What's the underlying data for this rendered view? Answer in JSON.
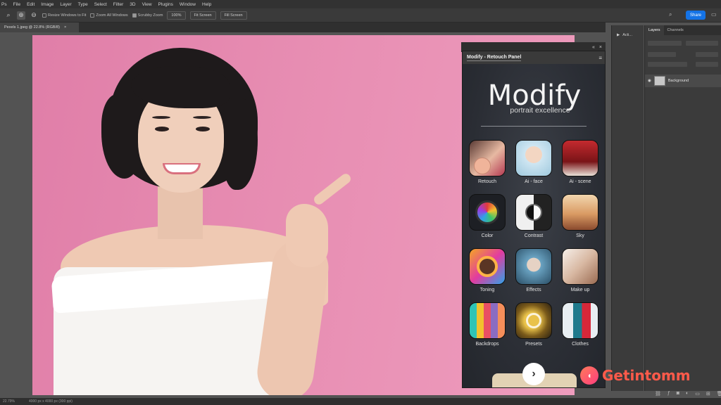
{
  "menu": [
    "Ps",
    "File",
    "Edit",
    "Image",
    "Layer",
    "Type",
    "Select",
    "Filter",
    "3D",
    "View",
    "Plugins",
    "Window",
    "Help"
  ],
  "options": {
    "resize_windows": "Resize Windows to Fit",
    "zoom_all": "Zoom All Windows",
    "scrubby_zoom": "Scrubby Zoom",
    "btn_100": "100%",
    "btn_fit": "Fit Screen",
    "btn_fill": "Fill Screen",
    "share": "Share"
  },
  "document": {
    "tab_title": "Pexels 1.jpeg @ 22.8% (RGB/8)",
    "close": "×"
  },
  "actions_tab": "Acti...",
  "panels": {
    "tabs": [
      "Layers",
      "Channels"
    ],
    "layer_name": "Background"
  },
  "modify": {
    "panel_title": "Modify - Retouch Panel",
    "logo": "Modify",
    "tagline": "portrait excellence",
    "tiles": [
      {
        "label": "Retouch"
      },
      {
        "label": "Ai - face"
      },
      {
        "label": "Ai - scene"
      },
      {
        "label": "Color"
      },
      {
        "label": "Contrast"
      },
      {
        "label": "Sky"
      },
      {
        "label": "Toning"
      },
      {
        "label": "Effects"
      },
      {
        "label": "Make up"
      },
      {
        "label": "Backdrops"
      },
      {
        "label": "Presets"
      },
      {
        "label": "Clothes"
      }
    ],
    "next": "›"
  },
  "status": {
    "zoom": "22.79%",
    "size": "4000 px x 4000 px (300 ppi)"
  },
  "watermark": {
    "text": "Getintomm"
  },
  "colors": {
    "share_blue": "#1473e6",
    "canvas_pink": "#e78db2",
    "watermark": "#ff5a4a"
  }
}
